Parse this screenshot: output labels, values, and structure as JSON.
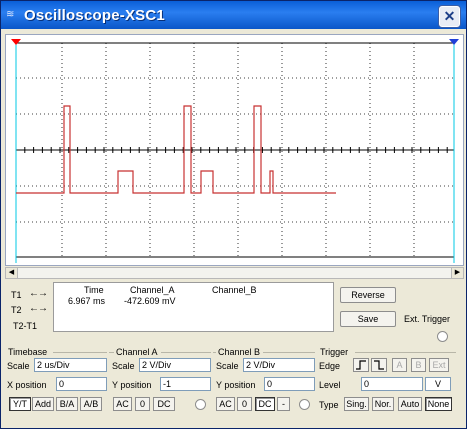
{
  "window": {
    "title": "Oscilloscope-XSC1",
    "icon": "oscilloscope-icon",
    "close_glyph": "✕"
  },
  "colors": {
    "trace_a": "#c83232",
    "grid": "#000000",
    "cursor_1": "#ff0000",
    "cursor_2": "#1f3fd8",
    "background": "#ffffff"
  },
  "cursors": {
    "t1_label": "T1",
    "t2_label": "T2",
    "t2_t1_label": "T2-T1",
    "arrows": "←→",
    "headers": {
      "time": "Time",
      "channel_a": "Channel_A",
      "channel_b": "Channel_B"
    },
    "t1_time": "6.967 ms",
    "t1_channel_a": "-472.609 mV",
    "t1_channel_b": ""
  },
  "buttons": {
    "reverse": "Reverse",
    "save": "Save",
    "ext_trigger": "Ext. Trigger"
  },
  "timebase": {
    "title": "Timebase",
    "scale_label": "Scale",
    "scale_value": "2 us/Div",
    "xpos_label": "X position",
    "xpos_value": "0",
    "modes": [
      "Y/T",
      "Add",
      "B/A",
      "A/B"
    ],
    "active_mode": "Y/T"
  },
  "channel_a": {
    "title": "Channel A",
    "scale_label": "Scale",
    "scale_value": "2  V/Div",
    "ypos_label": "Y position",
    "ypos_value": "-1",
    "coupling": [
      "AC",
      "0",
      "DC"
    ],
    "active_coupling": "DC"
  },
  "channel_b": {
    "title": "Channel B",
    "scale_label": "Scale",
    "scale_value": "2  V/Div",
    "ypos_label": "Y position",
    "ypos_value": "0",
    "coupling": [
      "AC",
      "0",
      "DC",
      "-"
    ],
    "active_coupling": "DC"
  },
  "trigger": {
    "title": "Trigger",
    "edge_label": "Edge",
    "edge_rising": "rising-edge-icon",
    "edge_falling": "falling-edge-icon",
    "sources": [
      "A",
      "B",
      "Ext"
    ],
    "level_label": "Level",
    "level_value": "0",
    "level_unit": "V",
    "type_label": "Type",
    "types": [
      "Sing.",
      "Nor.",
      "Auto",
      "None"
    ],
    "active_type": "None"
  }
}
